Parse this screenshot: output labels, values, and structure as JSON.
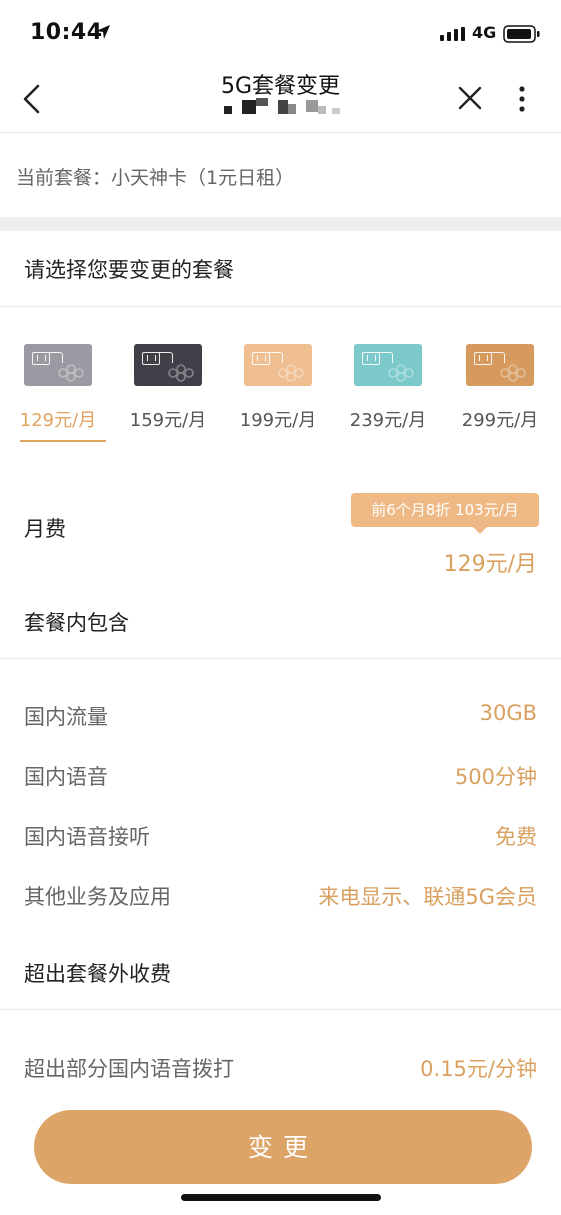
{
  "status_bar": {
    "time": "10:44",
    "network": "4G"
  },
  "nav": {
    "title": "5G套餐变更"
  },
  "current_plan": {
    "text": "当前套餐：小天神卡（1元日租）"
  },
  "select_title": "请选择您要变更的套餐",
  "plans": [
    {
      "price": "129元/月",
      "card_color": "#9a9aa2",
      "selected": true
    },
    {
      "price": "159元/月",
      "card_color": "#3f4048",
      "selected": false
    },
    {
      "price": "199元/月",
      "card_color": "#efbf92",
      "selected": false
    },
    {
      "price": "239元/月",
      "card_color": "#7cc9cc",
      "selected": false
    },
    {
      "price": "299元/月",
      "card_color": "#d69a5f",
      "selected": false
    }
  ],
  "fee": {
    "label": "月费",
    "promo": "前6个月8折 103元/月",
    "value": "129元/月"
  },
  "includes": {
    "title": "套餐内包含",
    "rows": [
      {
        "label": "国内流量",
        "value": "30GB"
      },
      {
        "label": "国内语音",
        "value": "500分钟"
      },
      {
        "label": "国内语音接听",
        "value": "免费"
      },
      {
        "label": "其他业务及应用",
        "value": "来电显示、联通5G会员"
      }
    ]
  },
  "extra": {
    "title": "超出套餐外收费",
    "rows": [
      {
        "label": "超出部分国内语音拨打",
        "value": "0.15元/分钟"
      }
    ]
  },
  "action": {
    "change_label": "变更"
  },
  "colors": {
    "accent": "#dca567",
    "value_text": "#d9a060",
    "promo_bg": "#eeb984"
  }
}
